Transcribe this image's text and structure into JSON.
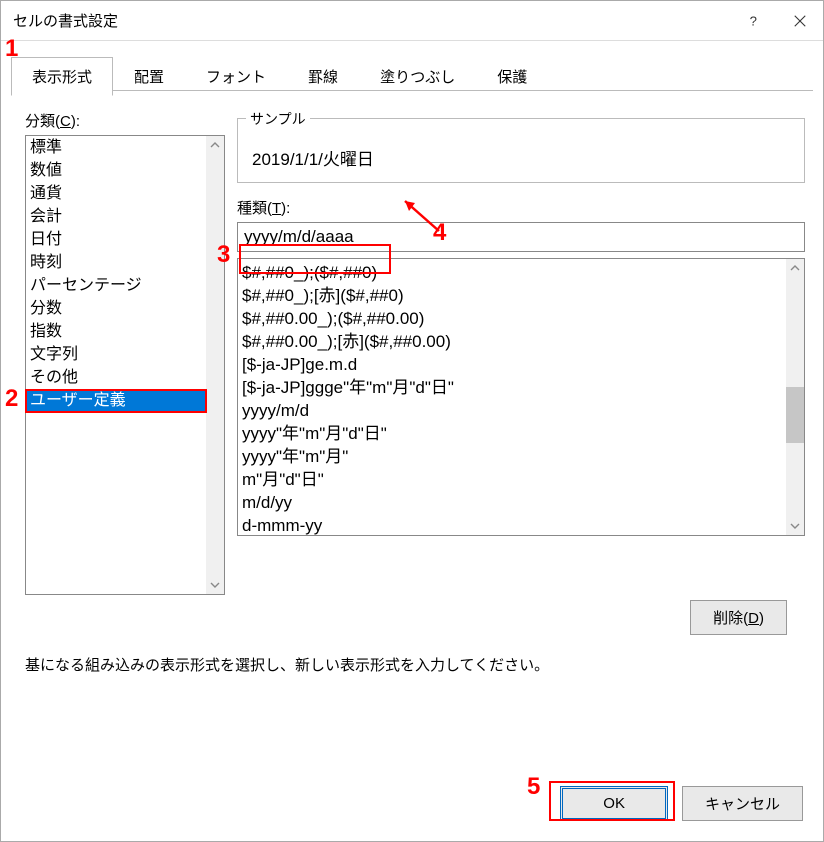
{
  "window": {
    "title": "セルの書式設定"
  },
  "tabs": [
    {
      "label": "表示形式",
      "active": true
    },
    {
      "label": "配置",
      "active": false
    },
    {
      "label": "フォント",
      "active": false
    },
    {
      "label": "罫線",
      "active": false
    },
    {
      "label": "塗りつぶし",
      "active": false
    },
    {
      "label": "保護",
      "active": false
    }
  ],
  "category": {
    "label_pre": "分類(",
    "label_key": "C",
    "label_post": "):",
    "items": [
      "標準",
      "数値",
      "通貨",
      "会計",
      "日付",
      "時刻",
      "パーセンテージ",
      "分数",
      "指数",
      "文字列",
      "その他",
      "ユーザー定義"
    ],
    "selected_index": 11
  },
  "sample": {
    "legend": "サンプル",
    "value": "2019/1/1/火曜日"
  },
  "type": {
    "label_pre": "種類(",
    "label_key": "T",
    "label_post": "):",
    "value": "yyyy/m/d/aaaa"
  },
  "format_list": [
    "$#,##0_);($#,##0)",
    "$#,##0_);[赤]($#,##0)",
    "$#,##0.00_);($#,##0.00)",
    "$#,##0.00_);[赤]($#,##0.00)",
    "[$-ja-JP]ge.m.d",
    "[$-ja-JP]ggge\"年\"m\"月\"d\"日\"",
    "yyyy/m/d",
    "yyyy\"年\"m\"月\"d\"日\"",
    "yyyy\"年\"m\"月\"",
    "m\"月\"d\"日\"",
    "m/d/yy",
    "d-mmm-yy"
  ],
  "buttons": {
    "delete_pre": "削除(",
    "delete_key": "D",
    "delete_post": ")",
    "ok": "OK",
    "cancel": "キャンセル"
  },
  "instruction": "基になる組み込みの表示形式を選択し、新しい表示形式を入力してください。",
  "annotations": {
    "n1": "1",
    "n2": "2",
    "n3": "3",
    "n4": "4",
    "n5": "5"
  }
}
